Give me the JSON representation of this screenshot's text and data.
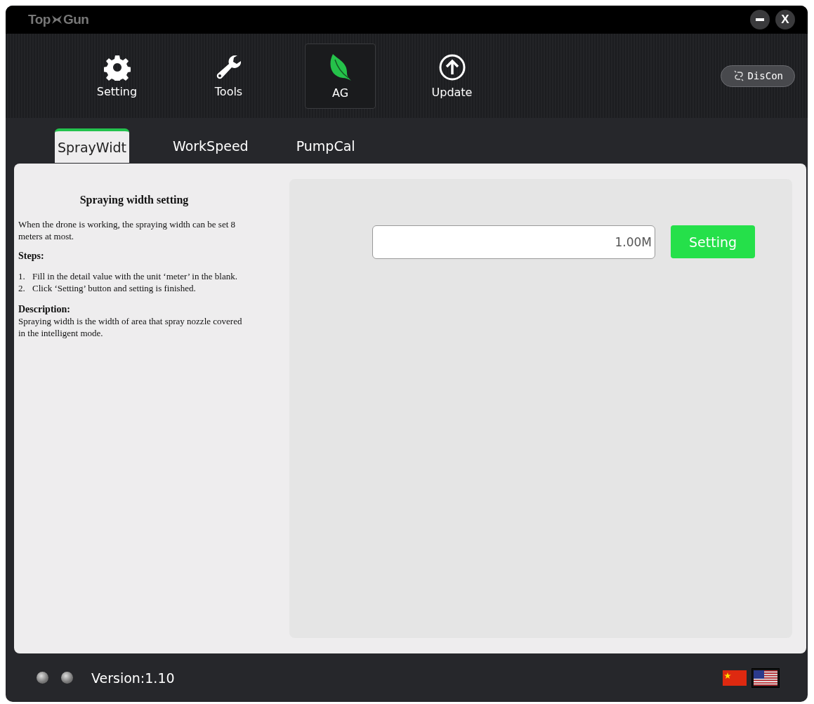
{
  "title_bar": {
    "logo_left": "Top",
    "logo_right": "Gun",
    "close_label": "X"
  },
  "nav": [
    {
      "label": "Setting",
      "selected": false
    },
    {
      "label": "Tools",
      "selected": false
    },
    {
      "label": "AG",
      "selected": true
    },
    {
      "label": "Update",
      "selected": false
    }
  ],
  "disconnect_button": {
    "label": "DisCon"
  },
  "tabs": [
    {
      "label": "SprayWidt",
      "selected": true
    },
    {
      "label": "WorkSpeed",
      "selected": false
    },
    {
      "label": "PumpCal",
      "selected": false
    }
  ],
  "help": {
    "title": "Spraying width setting",
    "intro": "When the drone is working, the spraying width can be set 8 meters at most.",
    "steps_heading": "Steps:",
    "steps": [
      {
        "number": "1.",
        "text": "Fill in the detail value with the unit ‘meter’ in the blank."
      },
      {
        "number": "2.",
        "text": "Click ‘Setting’ button and setting is finished."
      }
    ],
    "description_heading": "Description:",
    "description": "Spraying width is the width of area that spray nozzle covered in the intelligent mode."
  },
  "width_form": {
    "value": "1.00M",
    "button": "Setting"
  },
  "status_bar": {
    "lights": [
      {
        "on": false
      },
      {
        "on": false
      }
    ],
    "version": "Version:1.10",
    "languages": [
      {
        "selected": false
      },
      {
        "selected": true
      }
    ]
  }
}
